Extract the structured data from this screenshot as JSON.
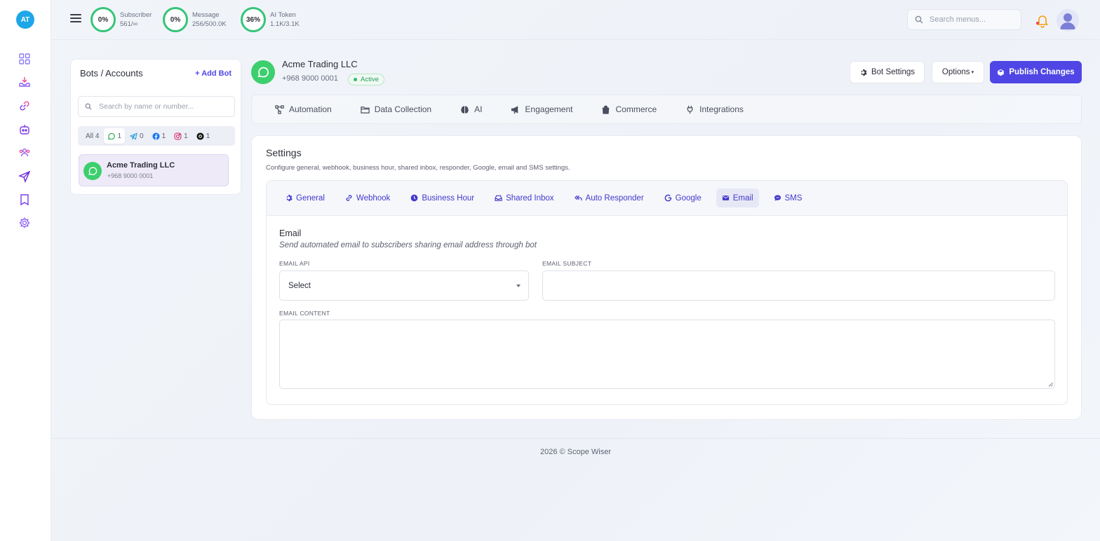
{
  "app": {
    "logo_initials": "AT",
    "brand_color": "#4f46e5",
    "accent_green": "#36c47a"
  },
  "rail": {
    "items": [
      {
        "icon": "dashboard-grid-icon"
      },
      {
        "icon": "inbox-download-icon"
      },
      {
        "icon": "link-chain-icon"
      },
      {
        "icon": "bot-icon"
      },
      {
        "icon": "users-group-icon"
      },
      {
        "icon": "send-icon"
      },
      {
        "icon": "bookmark-icon"
      },
      {
        "icon": "gear-icon"
      }
    ]
  },
  "topbar": {
    "stats": [
      {
        "percent": "0%",
        "label": "Subscriber",
        "value": "561/∞"
      },
      {
        "percent": "0%",
        "label": "Message",
        "value": "256/500.0K"
      },
      {
        "percent": "36%",
        "label": "AI Token",
        "value": "1.1K/3.1K"
      }
    ],
    "search_placeholder": "Search menus..."
  },
  "bots_panel": {
    "title": "Bots / Accounts",
    "add_label": "Add Bot",
    "search_placeholder": "Search by name or number...",
    "filters": [
      {
        "label": "All",
        "count": "4",
        "icon": ""
      },
      {
        "label": "",
        "count": "1",
        "icon": "whatsapp-icon"
      },
      {
        "label": "",
        "count": "0",
        "icon": "telegram-icon"
      },
      {
        "label": "",
        "count": "1",
        "icon": "facebook-icon"
      },
      {
        "label": "",
        "count": "1",
        "icon": "instagram-icon"
      },
      {
        "label": "",
        "count": "1",
        "icon": "threads-icon"
      }
    ],
    "items": [
      {
        "name": "Acme Trading LLC",
        "number": "+968 9000 0001"
      }
    ]
  },
  "account": {
    "name": "Acme Trading LLC",
    "number": "+968 9000 0001",
    "status": "Active"
  },
  "actions": {
    "bot_settings": "Bot Settings",
    "options": "Options",
    "publish": "Publish Changes"
  },
  "main_tabs": [
    {
      "label": "Automation",
      "icon": "flow-icon"
    },
    {
      "label": "Data Collection",
      "icon": "folder-icon"
    },
    {
      "label": "AI",
      "icon": "brain-icon"
    },
    {
      "label": "Engagement",
      "icon": "megaphone-icon"
    },
    {
      "label": "Commerce",
      "icon": "shopping-bag-icon"
    },
    {
      "label": "Integrations",
      "icon": "plug-icon"
    }
  ],
  "settings": {
    "title": "Settings",
    "description": "Configure general, webhook, business hour, shared inbox, responder, Google, email and SMS settings.",
    "tabs": [
      {
        "label": "General",
        "icon": "gear-icon"
      },
      {
        "label": "Webhook",
        "icon": "link-icon"
      },
      {
        "label": "Business Hour",
        "icon": "clock-icon"
      },
      {
        "label": "Shared Inbox",
        "icon": "inbox-icon"
      },
      {
        "label": "Auto Responder",
        "icon": "reply-all-icon"
      },
      {
        "label": "Google",
        "icon": "google-icon"
      },
      {
        "label": "Email",
        "icon": "envelope-icon"
      },
      {
        "label": "SMS",
        "icon": "chat-bubble-icon"
      }
    ],
    "active_tab": "Email",
    "email": {
      "title": "Email",
      "description": "Send automated email to subscribers sharing email address through bot",
      "api_label": "EMAIL API",
      "api_value": "Select",
      "subject_label": "EMAIL SUBJECT",
      "subject_value": "",
      "content_label": "EMAIL CONTENT",
      "content_value": ""
    }
  },
  "footer": {
    "text": "2026 © Scope Wiser"
  }
}
